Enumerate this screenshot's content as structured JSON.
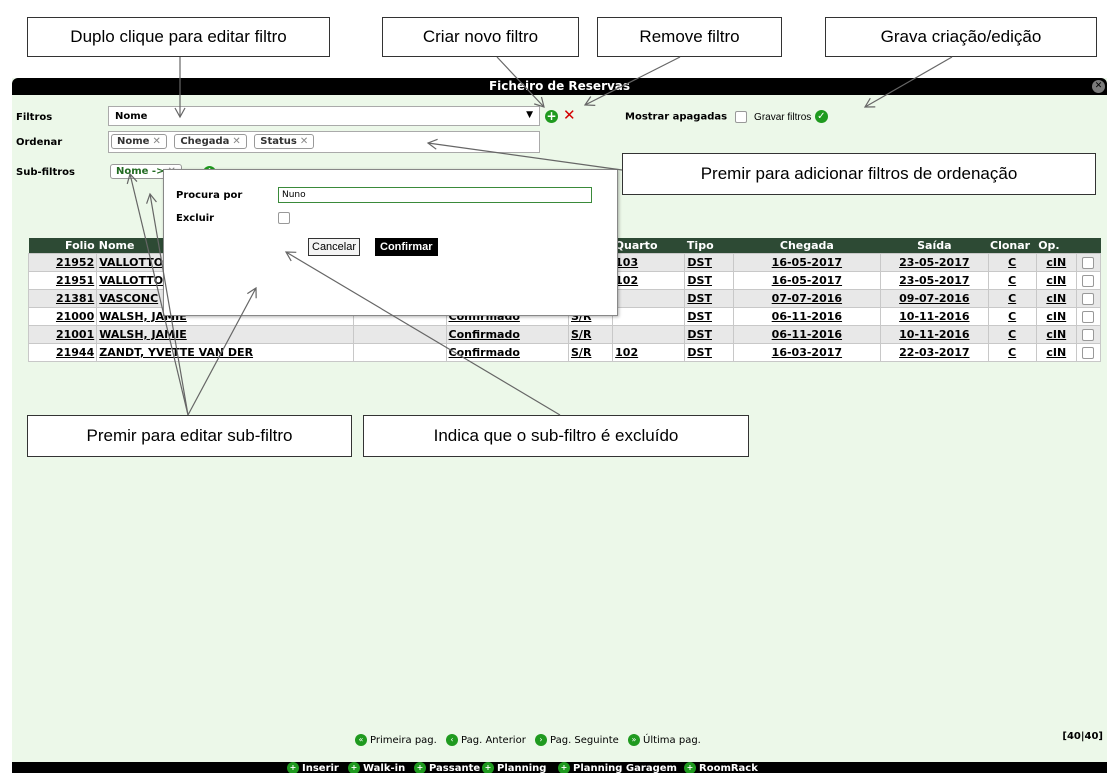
{
  "callouts": {
    "edit_filter": "Duplo clique para editar filtro",
    "new_filter": "Criar novo filtro",
    "remove_filter": "Remove filtro",
    "save": "Grava criação/edição",
    "sort": "Premir para adicionar filtros de ordenação",
    "edit_subfilter": "Premir para editar sub-filtro",
    "excluded": "Indica que o sub-filtro é excluído"
  },
  "window": {
    "title": "Ficheiro de Reservas",
    "close_icon": "close-icon"
  },
  "filters": {
    "label": "Filtros",
    "value": "Nome",
    "show_deleted": "Mostrar apagadas",
    "save_filters": "Gravar filtros"
  },
  "sort": {
    "label": "Ordenar",
    "tags": [
      "Nome",
      "Chegada",
      "Status"
    ]
  },
  "subfilters": {
    "label": "Sub-filtros",
    "tag": "Nome ->"
  },
  "popup": {
    "search_label": "Procura por",
    "search_value": "Nuno",
    "exclude_label": "Excluir",
    "cancel": "Cancelar",
    "confirm": "Confirmar"
  },
  "table": {
    "headers": [
      "Folio",
      "Nome",
      "",
      "",
      "f.",
      "Quarto",
      "Tipo",
      "Chegada",
      "Saída",
      "Clonar",
      "Op.",
      ""
    ],
    "rows": [
      {
        "folio": "21952",
        "nome": "VALLOTTO",
        "status": "",
        "sr": "",
        "quarto": "103",
        "tipo": "DST",
        "chegada": "16-05-2017",
        "saida": "23-05-2017",
        "clonar": "C",
        "op": "cIN"
      },
      {
        "folio": "21951",
        "nome": "VALLOTTO",
        "status": "",
        "sr": "",
        "quarto": "102",
        "tipo": "DST",
        "chegada": "16-05-2017",
        "saida": "23-05-2017",
        "clonar": "C",
        "op": "cIN"
      },
      {
        "folio": "21381",
        "nome": "VASCONC",
        "status": "",
        "sr": "/R",
        "quarto": "",
        "tipo": "DST",
        "chegada": "07-07-2016",
        "saida": "09-07-2016",
        "clonar": "C",
        "op": "cIN"
      },
      {
        "folio": "21000",
        "nome": "WALSH, JAMIE",
        "status": "Confirmado",
        "sr": "S/R",
        "quarto": "",
        "tipo": "DST",
        "chegada": "06-11-2016",
        "saida": "10-11-2016",
        "clonar": "C",
        "op": "cIN"
      },
      {
        "folio": "21001",
        "nome": "WALSH, JAMIE",
        "status": "Confirmado",
        "sr": "S/R",
        "quarto": "",
        "tipo": "DST",
        "chegada": "06-11-2016",
        "saida": "10-11-2016",
        "clonar": "C",
        "op": "cIN"
      },
      {
        "folio": "21944",
        "nome": "ZANDT, YVETTE VAN DER",
        "status": "Confirmado",
        "sr": "S/R",
        "quarto": "102",
        "tipo": "DST",
        "chegada": "16-03-2017",
        "saida": "22-03-2017",
        "clonar": "C",
        "op": "cIN"
      }
    ]
  },
  "pager": {
    "first": "Primeira pag.",
    "prev": "Pag. Anterior",
    "next": "Pag. Seguinte",
    "last": "Última pag.",
    "count": "[40|40]"
  },
  "bottom": [
    "Inserir",
    "Walk-in",
    "Passante",
    "Planning",
    "Planning Garagem",
    "RoomRack"
  ]
}
